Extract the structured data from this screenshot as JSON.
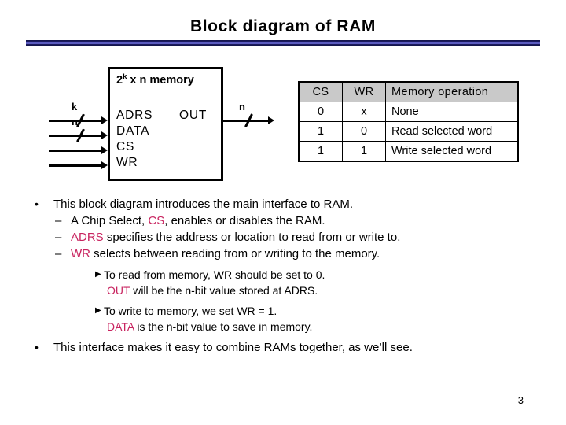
{
  "slide": {
    "title": "Block diagram of RAM",
    "page_number": "3",
    "accent_color": "#1a1a5e",
    "signal_color": "#c8235f",
    "header_fill": "#c9c9c9"
  },
  "diagram": {
    "box_title_base": "2",
    "box_title_exponent": "k",
    "box_title_rest": " x n memory",
    "inputs": [
      {
        "name": "ADRS",
        "bus_label": "k"
      },
      {
        "name": "DATA",
        "bus_label": "n"
      },
      {
        "name": "CS",
        "bus_label": ""
      },
      {
        "name": "WR",
        "bus_label": ""
      }
    ],
    "output": {
      "name": "OUT",
      "bus_label": "n"
    }
  },
  "truth_table": {
    "headers": [
      "CS",
      "WR",
      "Memory operation"
    ],
    "rows": [
      {
        "cs": "0",
        "wr": "x",
        "op": "None"
      },
      {
        "cs": "1",
        "wr": "0",
        "op": "Read selected word"
      },
      {
        "cs": "1",
        "wr": "1",
        "op": "Write selected word"
      }
    ]
  },
  "body": {
    "b1": "This block diagram introduces the main interface to RAM.",
    "b1s1_pre": "A Chip Select, ",
    "b1s1_sig": "CS",
    "b1s1_post": ", enables or disables the RAM.",
    "b1s2_sig": "ADRS",
    "b1s2_post": " specifies the address or location to read from or write to.",
    "b1s3_sig": "WR",
    "b1s3_post": " selects between reading from or writing to the memory.",
    "b1s3a_line1": "To read from memory, WR should be set to 0.",
    "b1s3a_line2_sig": "OUT",
    "b1s3a_line2_post": " will be the n-bit value stored at ADRS.",
    "b1s3b_line1": "To write to memory, we set WR = 1.",
    "b1s3b_line2_sig": "DATA",
    "b1s3b_line2_post": " is the n-bit value to save in memory.",
    "b2": "This interface makes it easy to combine RAMs together, as we’ll see.",
    "bullet_lvl1": "•",
    "bullet_lvl2": "–",
    "bullet_lvl3": "▶"
  }
}
